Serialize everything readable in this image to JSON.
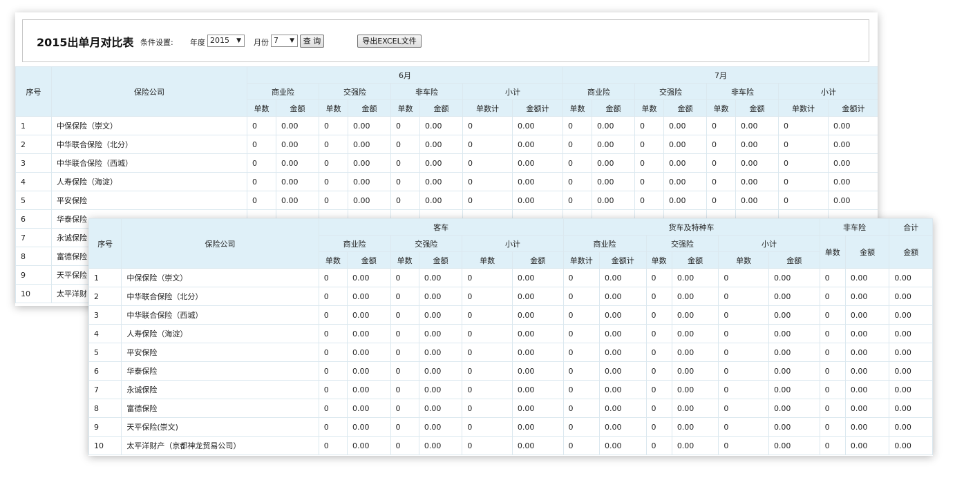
{
  "toolbar": {
    "title": "2015出单月对比表",
    "cond_label": "条件设置:",
    "year_label": "年度",
    "year_value": "2015",
    "month_label": "月份",
    "month_value": "7",
    "query_label": "查 询",
    "export_label": "导出EXCEL文件",
    "dropdown_arrow": "▼"
  },
  "monthly_table": {
    "seq_header": "序号",
    "company_header": "保险公司",
    "months": [
      "6月",
      "7月"
    ],
    "groups": [
      "商业险",
      "交强险",
      "非车险",
      "小计"
    ],
    "sub_headers": [
      "单数",
      "金额",
      "单数",
      "金额",
      "单数",
      "金额",
      "单数计",
      "金额计",
      "单数",
      "金额",
      "单数",
      "金额",
      "单数",
      "金额",
      "单数计",
      "金额计"
    ],
    "rows": [
      {
        "seq": "1",
        "company": "中保保险（崇文）",
        "values": [
          "0",
          "0.00",
          "0",
          "0.00",
          "0",
          "0.00",
          "0",
          "0.00",
          "0",
          "0.00",
          "0",
          "0.00",
          "0",
          "0.00",
          "0",
          "0.00"
        ]
      },
      {
        "seq": "2",
        "company": "中华联合保险（北分）",
        "values": [
          "0",
          "0.00",
          "0",
          "0.00",
          "0",
          "0.00",
          "0",
          "0.00",
          "0",
          "0.00",
          "0",
          "0.00",
          "0",
          "0.00",
          "0",
          "0.00"
        ]
      },
      {
        "seq": "3",
        "company": "中华联合保险（西城）",
        "values": [
          "0",
          "0.00",
          "0",
          "0.00",
          "0",
          "0.00",
          "0",
          "0.00",
          "0",
          "0.00",
          "0",
          "0.00",
          "0",
          "0.00",
          "0",
          "0.00"
        ]
      },
      {
        "seq": "4",
        "company": "人寿保险（海淀）",
        "values": [
          "0",
          "0.00",
          "0",
          "0.00",
          "0",
          "0.00",
          "0",
          "0.00",
          "0",
          "0.00",
          "0",
          "0.00",
          "0",
          "0.00",
          "0",
          "0.00"
        ]
      },
      {
        "seq": "5",
        "company": "平安保险",
        "values": [
          "0",
          "0.00",
          "0",
          "0.00",
          "0",
          "0.00",
          "0",
          "0.00",
          "0",
          "0.00",
          "0",
          "0.00",
          "0",
          "0.00",
          "0",
          "0.00"
        ]
      },
      {
        "seq": "6",
        "company": "华泰保险",
        "values": [
          "",
          "",
          "",
          "",
          "",
          "",
          "",
          "",
          "",
          "",
          "",
          "",
          "",
          "",
          "",
          ""
        ]
      },
      {
        "seq": "7",
        "company": "永诚保险",
        "values": [
          "",
          "",
          "",
          "",
          "",
          "",
          "",
          "",
          "",
          "",
          "",
          "",
          "",
          "",
          "",
          ""
        ]
      },
      {
        "seq": "8",
        "company": "富德保险",
        "values": [
          "",
          "",
          "",
          "",
          "",
          "",
          "",
          "",
          "",
          "",
          "",
          "",
          "",
          "",
          "",
          ""
        ]
      },
      {
        "seq": "9",
        "company": "天平保险",
        "values": [
          "",
          "",
          "",
          "",
          "",
          "",
          "",
          "",
          "",
          "",
          "",
          "",
          "",
          "",
          "",
          ""
        ]
      },
      {
        "seq": "10",
        "company": "太平洋财",
        "values": [
          "",
          "",
          "",
          "",
          "",
          "",
          "",
          "",
          "",
          "",
          "",
          "",
          "",
          "",
          "",
          ""
        ]
      }
    ]
  },
  "category_table": {
    "seq_header": "序号",
    "company_header": "保险公司",
    "passenger_header": "客车",
    "truck_header": "货车及特种车",
    "noncar_header": "非车险",
    "total_header": "合计",
    "passenger_groups": [
      "商业险",
      "交强险",
      "小计"
    ],
    "truck_groups": [
      "商业险",
      "交强险",
      "小计"
    ],
    "sub_headers": [
      "单数",
      "金额",
      "单数",
      "金额",
      "单数",
      "金额",
      "单数计",
      "金额计",
      "单数",
      "金额",
      "单数",
      "金额"
    ],
    "noncar_sub": [
      "单数",
      "金额"
    ],
    "total_sub": "金额",
    "rows": [
      {
        "seq": "1",
        "company": "中保保险（崇文）",
        "values": [
          "0",
          "0.00",
          "0",
          "0.00",
          "0",
          "0.00",
          "0",
          "0.00",
          "0",
          "0.00",
          "0",
          "0.00",
          "0",
          "0.00",
          "0.00"
        ]
      },
      {
        "seq": "2",
        "company": "中华联合保险（北分）",
        "values": [
          "0",
          "0.00",
          "0",
          "0.00",
          "0",
          "0.00",
          "0",
          "0.00",
          "0",
          "0.00",
          "0",
          "0.00",
          "0",
          "0.00",
          "0.00"
        ]
      },
      {
        "seq": "3",
        "company": "中华联合保险（西城）",
        "values": [
          "0",
          "0.00",
          "0",
          "0.00",
          "0",
          "0.00",
          "0",
          "0.00",
          "0",
          "0.00",
          "0",
          "0.00",
          "0",
          "0.00",
          "0.00"
        ]
      },
      {
        "seq": "4",
        "company": "人寿保险（海淀）",
        "values": [
          "0",
          "0.00",
          "0",
          "0.00",
          "0",
          "0.00",
          "0",
          "0.00",
          "0",
          "0.00",
          "0",
          "0.00",
          "0",
          "0.00",
          "0.00"
        ]
      },
      {
        "seq": "5",
        "company": "平安保险",
        "values": [
          "0",
          "0.00",
          "0",
          "0.00",
          "0",
          "0.00",
          "0",
          "0.00",
          "0",
          "0.00",
          "0",
          "0.00",
          "0",
          "0.00",
          "0.00"
        ]
      },
      {
        "seq": "6",
        "company": "华泰保险",
        "values": [
          "0",
          "0.00",
          "0",
          "0.00",
          "0",
          "0.00",
          "0",
          "0.00",
          "0",
          "0.00",
          "0",
          "0.00",
          "0",
          "0.00",
          "0.00"
        ]
      },
      {
        "seq": "7",
        "company": "永诚保险",
        "values": [
          "0",
          "0.00",
          "0",
          "0.00",
          "0",
          "0.00",
          "0",
          "0.00",
          "0",
          "0.00",
          "0",
          "0.00",
          "0",
          "0.00",
          "0.00"
        ]
      },
      {
        "seq": "8",
        "company": "富德保险",
        "values": [
          "0",
          "0.00",
          "0",
          "0.00",
          "0",
          "0.00",
          "0",
          "0.00",
          "0",
          "0.00",
          "0",
          "0.00",
          "0",
          "0.00",
          "0.00"
        ]
      },
      {
        "seq": "9",
        "company": "天平保险(崇文)",
        "values": [
          "0",
          "0.00",
          "0",
          "0.00",
          "0",
          "0.00",
          "0",
          "0.00",
          "0",
          "0.00",
          "0",
          "0.00",
          "0",
          "0.00",
          "0.00"
        ]
      },
      {
        "seq": "10",
        "company": "太平洋财产（京都神龙贸易公司）",
        "values": [
          "0",
          "0.00",
          "0",
          "0.00",
          "0",
          "0.00",
          "0",
          "0.00",
          "0",
          "0.00",
          "0",
          "0.00",
          "0",
          "0.00",
          "0.00"
        ]
      }
    ]
  }
}
